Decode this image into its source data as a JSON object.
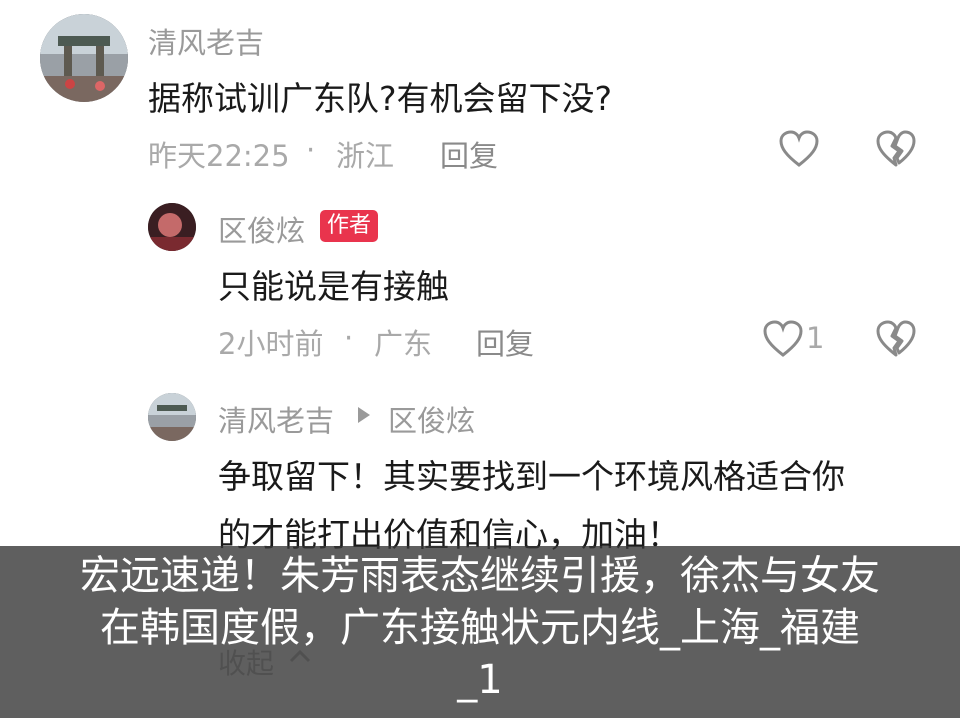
{
  "comments": [
    {
      "user": "清风老吉",
      "text": "据称试训广东队?有机会留下没?",
      "time": "昨天22:25",
      "location": "浙江",
      "reply_label": "回复",
      "like_count": ""
    },
    {
      "user": "区俊炫",
      "badge": "作者",
      "text": "只能说是有接触",
      "time": "2小时前",
      "location": "广东",
      "reply_label": "回复",
      "like_count": "1"
    },
    {
      "user": "清风老吉",
      "reply_to": "区俊炫",
      "text_line1": "争取留下！其实要找到一个环境风格适合你",
      "text_line2": "的才能打出价值和信心，加油！"
    }
  ],
  "collapse_label": "收起",
  "overlay_title": {
    "line1": "宏远速递！朱芳雨表态继续引援，徐杰与女友",
    "line2": "在韩国度假，广东接触状元内线_上海_福建",
    "line3": "_1"
  },
  "colors": {
    "badge": "#e9344d",
    "name": "#9a9a9a",
    "text": "#1a1a1a",
    "overlay": "#373737"
  },
  "icons": [
    "heart-icon",
    "dislike-broken-heart-icon",
    "play-arrow-icon",
    "chevron-up-icon"
  ]
}
